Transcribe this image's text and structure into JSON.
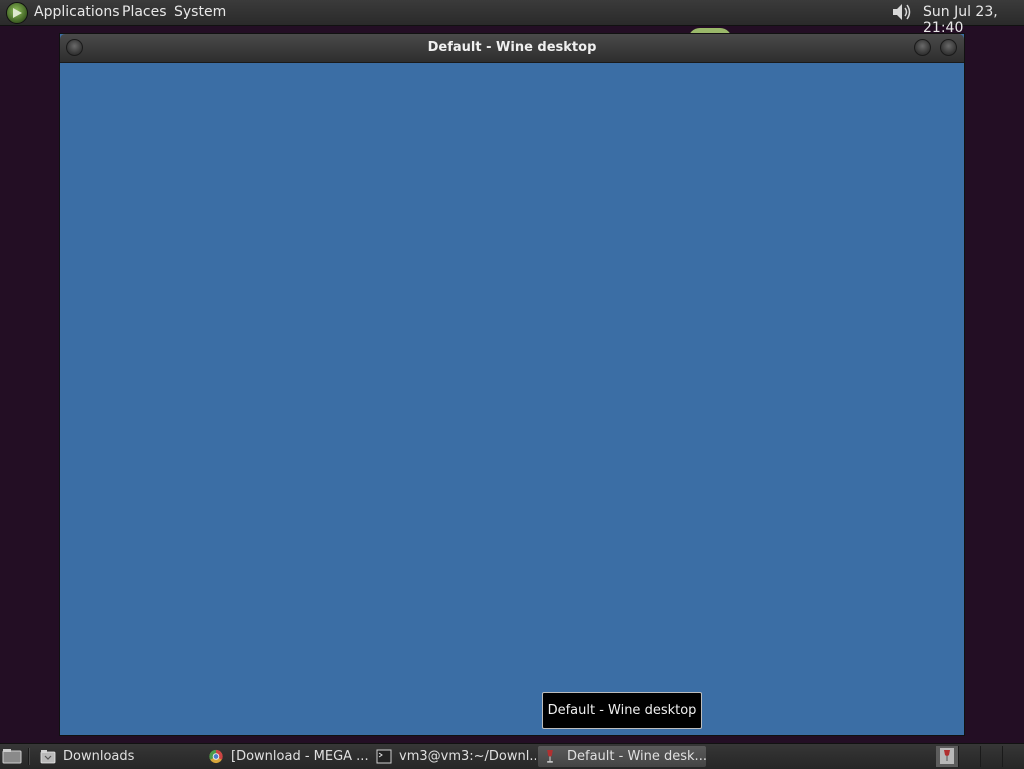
{
  "top_panel": {
    "menus": {
      "applications": "Applications",
      "places": "Places",
      "system": "System"
    },
    "clock": "Sun Jul 23, 21:40"
  },
  "window": {
    "title": "Default - Wine desktop",
    "desktop_color": "#3b6ea5"
  },
  "tooltip": {
    "text": "Default - Wine desktop"
  },
  "taskbar": {
    "tasks": [
      {
        "label": "Downloads",
        "icon": "folder-icon"
      },
      {
        "label": "[Download - MEGA ...",
        "icon": "chrome-icon"
      },
      {
        "label": "vm3@vm3:~/Downl...",
        "icon": "terminal-icon"
      },
      {
        "label": "Default - Wine desk...",
        "icon": "wine-icon",
        "active": true
      }
    ]
  }
}
